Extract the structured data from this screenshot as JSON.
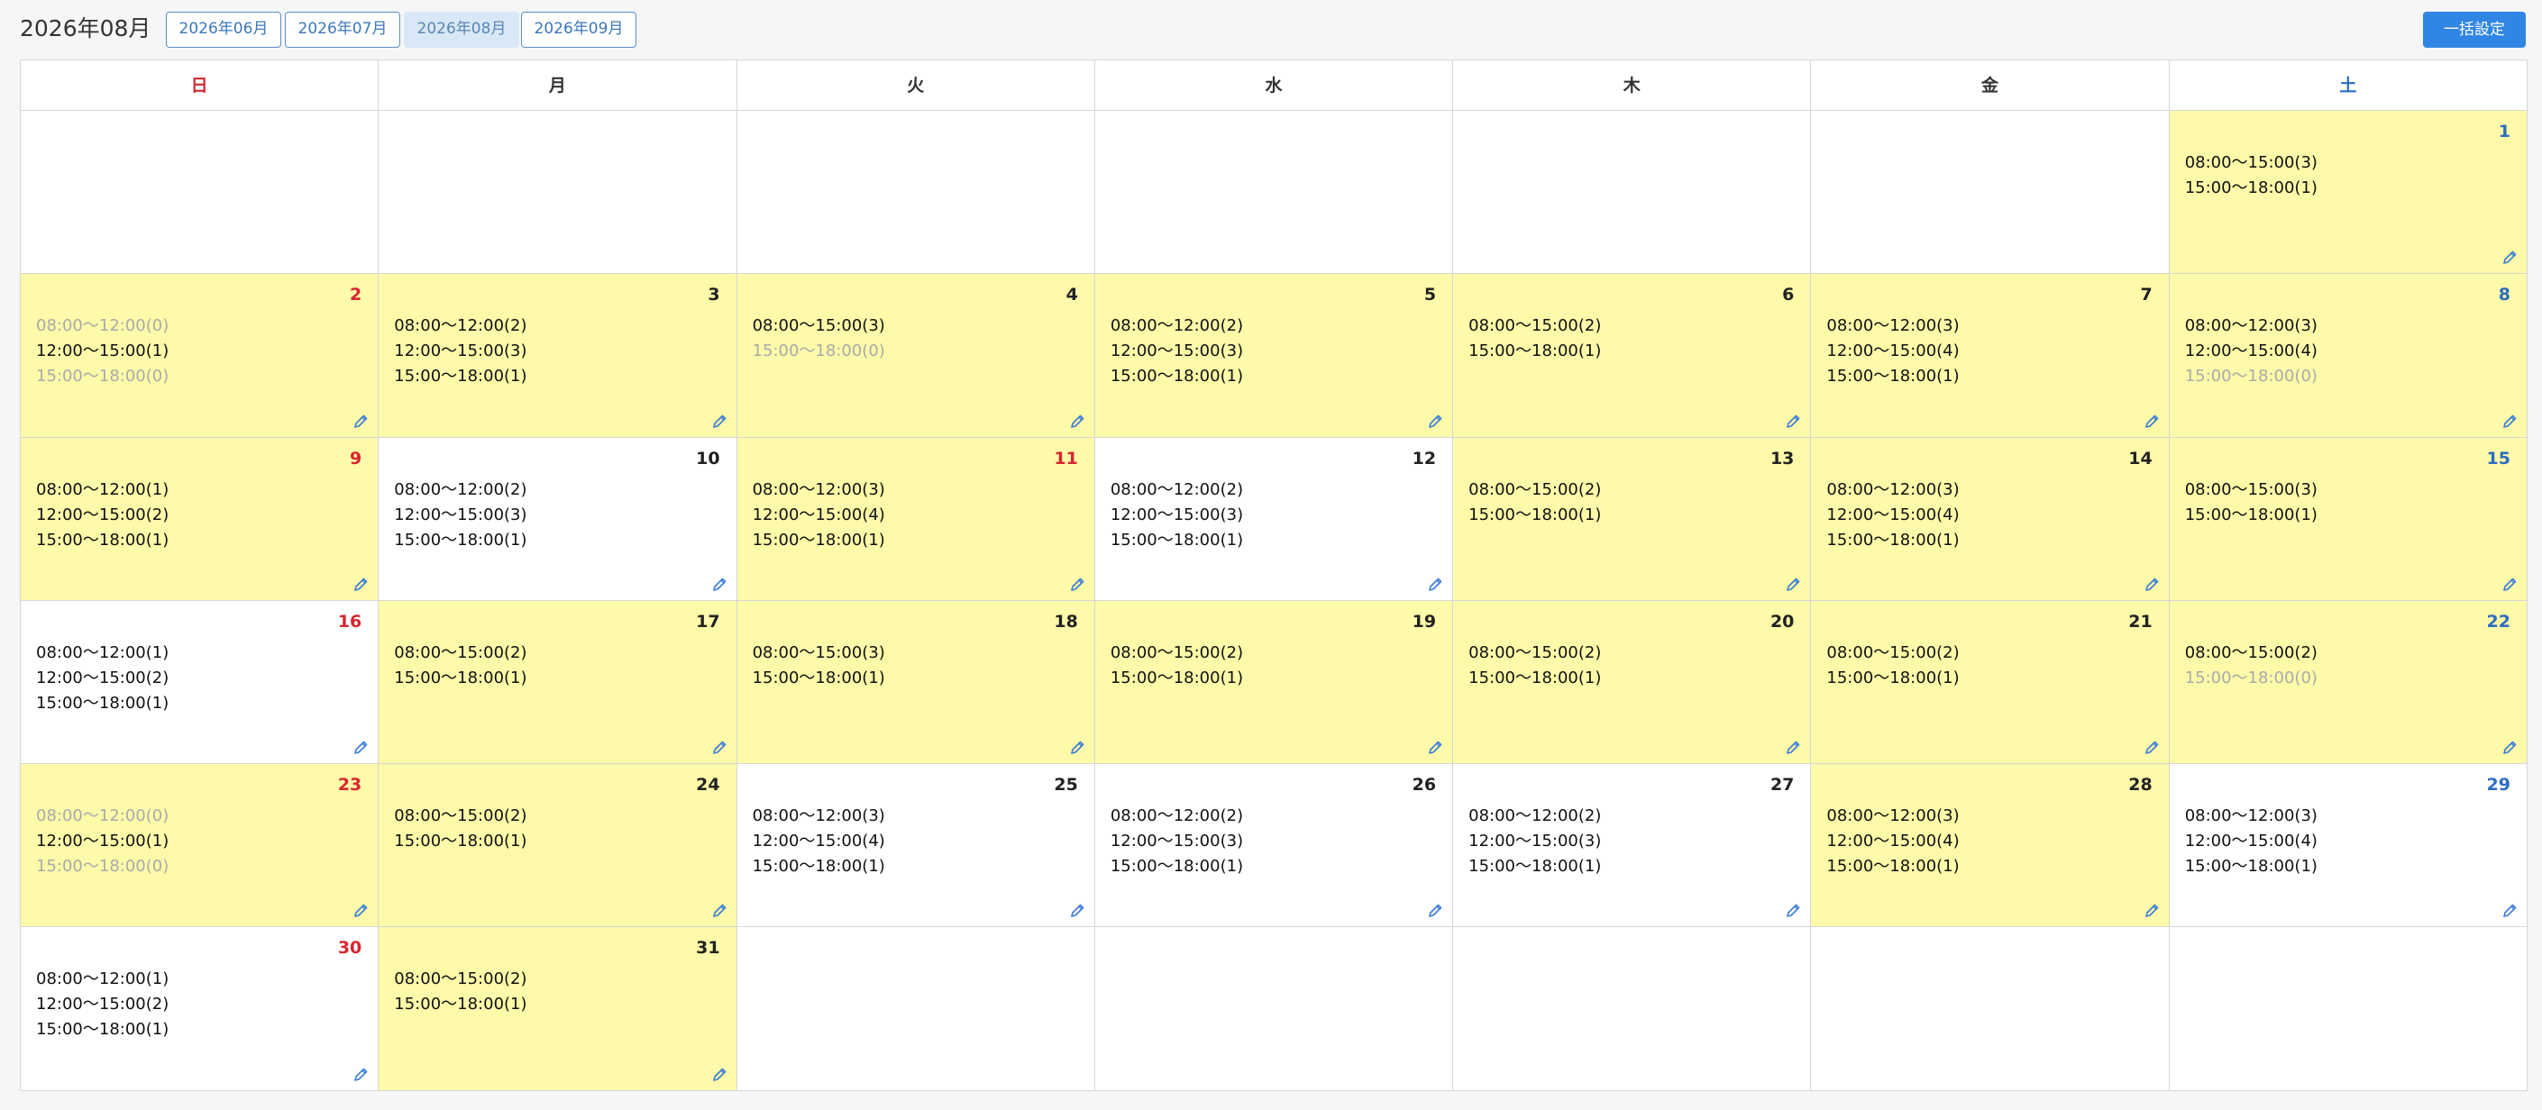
{
  "header": {
    "title": "2026年08月",
    "month_buttons": [
      "2026年06月",
      "2026年07月",
      "2026年08月",
      "2026年09月"
    ],
    "active_month_index": 2,
    "bulk_label": "一括設定"
  },
  "colors": {
    "highlight": "#fdfaa9",
    "sunday": "#d8262f",
    "saturday": "#2e6cc1",
    "accent": "#2f86e4"
  },
  "weekdays": [
    "日",
    "月",
    "火",
    "水",
    "木",
    "金",
    "土"
  ],
  "weeks": [
    [
      null,
      null,
      null,
      null,
      null,
      null,
      {
        "day": "1",
        "hl": true,
        "slots": [
          [
            "08:00〜15:00(3)",
            true
          ],
          [
            "15:00〜18:00(1)",
            true
          ]
        ]
      }
    ],
    [
      {
        "day": "2",
        "hl": true,
        "slots": [
          [
            "08:00〜12:00(0)",
            false
          ],
          [
            "12:00〜15:00(1)",
            true
          ],
          [
            "15:00〜18:00(0)",
            false
          ]
        ]
      },
      {
        "day": "3",
        "hl": true,
        "slots": [
          [
            "08:00〜12:00(2)",
            true
          ],
          [
            "12:00〜15:00(3)",
            true
          ],
          [
            "15:00〜18:00(1)",
            true
          ]
        ]
      },
      {
        "day": "4",
        "hl": true,
        "slots": [
          [
            "08:00〜15:00(3)",
            true
          ],
          [
            "15:00〜18:00(0)",
            false
          ]
        ]
      },
      {
        "day": "5",
        "hl": true,
        "slots": [
          [
            "08:00〜12:00(2)",
            true
          ],
          [
            "12:00〜15:00(3)",
            true
          ],
          [
            "15:00〜18:00(1)",
            true
          ]
        ]
      },
      {
        "day": "6",
        "hl": true,
        "slots": [
          [
            "08:00〜15:00(2)",
            true
          ],
          [
            "15:00〜18:00(1)",
            true
          ]
        ]
      },
      {
        "day": "7",
        "hl": true,
        "slots": [
          [
            "08:00〜12:00(3)",
            true
          ],
          [
            "12:00〜15:00(4)",
            true
          ],
          [
            "15:00〜18:00(1)",
            true
          ]
        ]
      },
      {
        "day": "8",
        "hl": true,
        "slots": [
          [
            "08:00〜12:00(3)",
            true
          ],
          [
            "12:00〜15:00(4)",
            true
          ],
          [
            "15:00〜18:00(0)",
            false
          ]
        ]
      }
    ],
    [
      {
        "day": "9",
        "hl": true,
        "slots": [
          [
            "08:00〜12:00(1)",
            true
          ],
          [
            "12:00〜15:00(2)",
            true
          ],
          [
            "15:00〜18:00(1)",
            true
          ]
        ]
      },
      {
        "day": "10",
        "hl": false,
        "slots": [
          [
            "08:00〜12:00(2)",
            true
          ],
          [
            "12:00〜15:00(3)",
            true
          ],
          [
            "15:00〜18:00(1)",
            true
          ]
        ]
      },
      {
        "day": "11",
        "hl": true,
        "red": true,
        "slots": [
          [
            "08:00〜12:00(3)",
            true
          ],
          [
            "12:00〜15:00(4)",
            true
          ],
          [
            "15:00〜18:00(1)",
            true
          ]
        ]
      },
      {
        "day": "12",
        "hl": false,
        "slots": [
          [
            "08:00〜12:00(2)",
            true
          ],
          [
            "12:00〜15:00(3)",
            true
          ],
          [
            "15:00〜18:00(1)",
            true
          ]
        ]
      },
      {
        "day": "13",
        "hl": true,
        "slots": [
          [
            "08:00〜15:00(2)",
            true
          ],
          [
            "15:00〜18:00(1)",
            true
          ]
        ]
      },
      {
        "day": "14",
        "hl": true,
        "slots": [
          [
            "08:00〜12:00(3)",
            true
          ],
          [
            "12:00〜15:00(4)",
            true
          ],
          [
            "15:00〜18:00(1)",
            true
          ]
        ]
      },
      {
        "day": "15",
        "hl": true,
        "slots": [
          [
            "08:00〜15:00(3)",
            true
          ],
          [
            "15:00〜18:00(1)",
            true
          ]
        ]
      }
    ],
    [
      {
        "day": "16",
        "hl": false,
        "slots": [
          [
            "08:00〜12:00(1)",
            true
          ],
          [
            "12:00〜15:00(2)",
            true
          ],
          [
            "15:00〜18:00(1)",
            true
          ]
        ]
      },
      {
        "day": "17",
        "hl": true,
        "slots": [
          [
            "08:00〜15:00(2)",
            true
          ],
          [
            "15:00〜18:00(1)",
            true
          ]
        ]
      },
      {
        "day": "18",
        "hl": true,
        "slots": [
          [
            "08:00〜15:00(3)",
            true
          ],
          [
            "15:00〜18:00(1)",
            true
          ]
        ]
      },
      {
        "day": "19",
        "hl": true,
        "slots": [
          [
            "08:00〜15:00(2)",
            true
          ],
          [
            "15:00〜18:00(1)",
            true
          ]
        ]
      },
      {
        "day": "20",
        "hl": true,
        "slots": [
          [
            "08:00〜15:00(2)",
            true
          ],
          [
            "15:00〜18:00(1)",
            true
          ]
        ]
      },
      {
        "day": "21",
        "hl": true,
        "slots": [
          [
            "08:00〜15:00(2)",
            true
          ],
          [
            "15:00〜18:00(1)",
            true
          ]
        ]
      },
      {
        "day": "22",
        "hl": true,
        "slots": [
          [
            "08:00〜15:00(2)",
            true
          ],
          [
            "15:00〜18:00(0)",
            false
          ]
        ]
      }
    ],
    [
      {
        "day": "23",
        "hl": true,
        "slots": [
          [
            "08:00〜12:00(0)",
            false
          ],
          [
            "12:00〜15:00(1)",
            true
          ],
          [
            "15:00〜18:00(0)",
            false
          ]
        ]
      },
      {
        "day": "24",
        "hl": true,
        "slots": [
          [
            "08:00〜15:00(2)",
            true
          ],
          [
            "15:00〜18:00(1)",
            true
          ]
        ]
      },
      {
        "day": "25",
        "hl": false,
        "slots": [
          [
            "08:00〜12:00(3)",
            true
          ],
          [
            "12:00〜15:00(4)",
            true
          ],
          [
            "15:00〜18:00(1)",
            true
          ]
        ]
      },
      {
        "day": "26",
        "hl": false,
        "slots": [
          [
            "08:00〜12:00(2)",
            true
          ],
          [
            "12:00〜15:00(3)",
            true
          ],
          [
            "15:00〜18:00(1)",
            true
          ]
        ]
      },
      {
        "day": "27",
        "hl": false,
        "slots": [
          [
            "08:00〜12:00(2)",
            true
          ],
          [
            "12:00〜15:00(3)",
            true
          ],
          [
            "15:00〜18:00(1)",
            true
          ]
        ]
      },
      {
        "day": "28",
        "hl": true,
        "slots": [
          [
            "08:00〜12:00(3)",
            true
          ],
          [
            "12:00〜15:00(4)",
            true
          ],
          [
            "15:00〜18:00(1)",
            true
          ]
        ]
      },
      {
        "day": "29",
        "hl": false,
        "slots": [
          [
            "08:00〜12:00(3)",
            true
          ],
          [
            "12:00〜15:00(4)",
            true
          ],
          [
            "15:00〜18:00(1)",
            true
          ]
        ]
      }
    ],
    [
      {
        "day": "30",
        "hl": false,
        "slots": [
          [
            "08:00〜12:00(1)",
            true
          ],
          [
            "12:00〜15:00(2)",
            true
          ],
          [
            "15:00〜18:00(1)",
            true
          ]
        ]
      },
      {
        "day": "31",
        "hl": true,
        "slots": [
          [
            "08:00〜15:00(2)",
            true
          ],
          [
            "15:00〜18:00(1)",
            true
          ]
        ]
      },
      null,
      null,
      null,
      null,
      null
    ]
  ],
  "icons": {
    "edit": "pencil-icon"
  }
}
